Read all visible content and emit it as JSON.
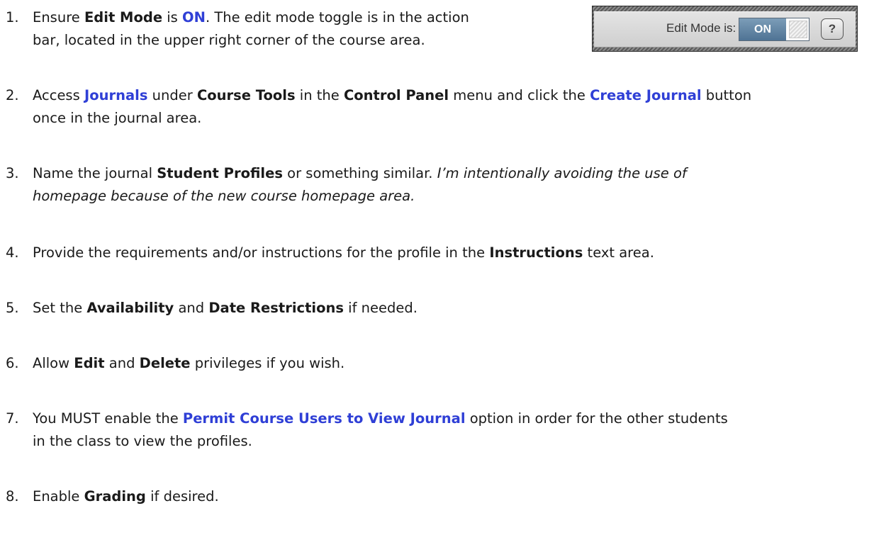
{
  "steps": [
    {
      "n": "1.",
      "parts": [
        [
          "Ensure ",
          ""
        ],
        [
          "Edit Mode",
          "b"
        ],
        [
          " is ",
          ""
        ],
        [
          "ON",
          "bl"
        ],
        [
          ".  The edit mode toggle is in the action",
          ""
        ]
      ],
      "cont": [
        [
          " bar, located in the upper right corner of the course area.",
          ""
        ]
      ]
    },
    {
      "n": "2.",
      "parts": [
        [
          "Access ",
          ""
        ],
        [
          "Journals",
          "bl"
        ],
        [
          " under ",
          ""
        ],
        [
          "Course Tools",
          "b"
        ],
        [
          " in the ",
          ""
        ],
        [
          "Control Panel",
          "b"
        ],
        [
          " menu and click the ",
          ""
        ],
        [
          "Create Journal",
          "bl"
        ],
        [
          " button",
          ""
        ]
      ],
      "cont": [
        [
          "once in the journal area.",
          ""
        ]
      ]
    },
    {
      "n": "3.",
      "parts": [
        [
          "Name the journal ",
          ""
        ],
        [
          "Student Profiles",
          "b"
        ],
        [
          " or something similar.  ",
          ""
        ],
        [
          "I’m intentionally avoiding the use of",
          "it"
        ]
      ],
      "cont": [
        [
          "homepage because of the new course homepage area.",
          "it"
        ]
      ]
    },
    {
      "n": "4.",
      "parts": [
        [
          "Provide the requirements and/or instructions for the profile in the ",
          ""
        ],
        [
          "Instructions",
          "b"
        ],
        [
          " text area.",
          ""
        ]
      ],
      "cont": []
    },
    {
      "n": "5.",
      "parts": [
        [
          "Set the ",
          ""
        ],
        [
          "Availability",
          "b"
        ],
        [
          " and ",
          ""
        ],
        [
          "Date Restrictions",
          "b"
        ],
        [
          " if needed.",
          ""
        ]
      ],
      "cont": []
    },
    {
      "n": "6.",
      "parts": [
        [
          "Allow ",
          ""
        ],
        [
          "Edit",
          "b"
        ],
        [
          " and ",
          ""
        ],
        [
          "Delete",
          "b"
        ],
        [
          " privileges if you wish.",
          ""
        ]
      ],
      "cont": []
    },
    {
      "n": "7.",
      "parts": [
        [
          "You MUST enable the ",
          ""
        ],
        [
          "Permit Course Users to View Journal",
          "bl"
        ],
        [
          " option in order for the other students",
          ""
        ]
      ],
      "cont": [
        [
          "in the class to view the profiles.",
          ""
        ]
      ]
    },
    {
      "n": "8.",
      "parts": [
        [
          "Enable ",
          ""
        ],
        [
          "Grading",
          "b"
        ],
        [
          " if desired.",
          ""
        ]
      ],
      "cont": []
    }
  ],
  "edit_mode": {
    "label": "Edit Mode is:",
    "state": "ON",
    "help": "?"
  },
  "colors": {
    "link": "#2f3fd6",
    "toggle_on": "#5f82a2"
  }
}
